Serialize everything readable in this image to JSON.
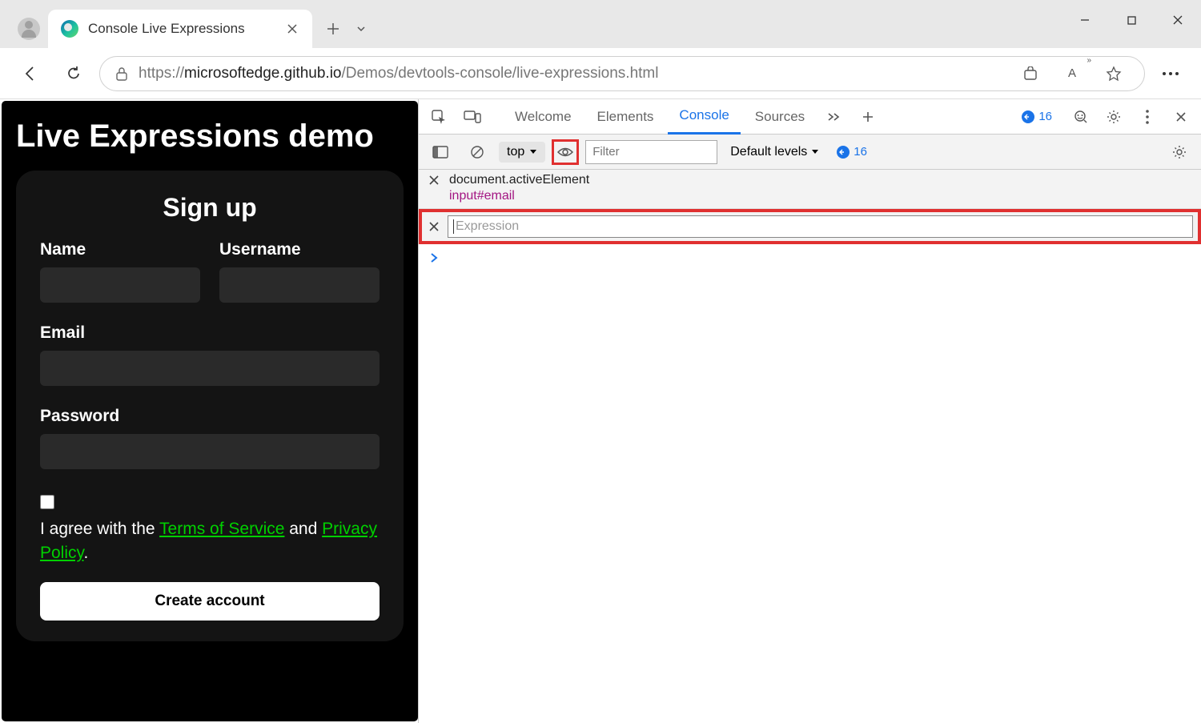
{
  "browser": {
    "tab_title": "Console Live Expressions",
    "url_protocol": "https://",
    "url_domain": "microsoftedge.github.io",
    "url_path": "/Demos/devtools-console/live-expressions.html"
  },
  "page": {
    "heading": "Live Expressions demo",
    "form": {
      "title": "Sign up",
      "name_label": "Name",
      "username_label": "Username",
      "email_label": "Email",
      "password_label": "Password",
      "terms_prefix": "I agree with the ",
      "terms_link": "Terms of Service",
      "terms_mid": " and ",
      "privacy_link": "Privacy Policy",
      "terms_suffix": ".",
      "submit_label": "Create account"
    }
  },
  "devtools": {
    "tabs": {
      "welcome": "Welcome",
      "elements": "Elements",
      "console": "Console",
      "sources": "Sources"
    },
    "badge_count": "16",
    "toolbar": {
      "context": "top",
      "filter_placeholder": "Filter",
      "levels": "Default levels",
      "issue_count": "16"
    },
    "live_expressions": [
      {
        "expression": "document.activeElement",
        "output": "input#email"
      }
    ],
    "editor_placeholder": "Expression",
    "prompt": "›"
  }
}
